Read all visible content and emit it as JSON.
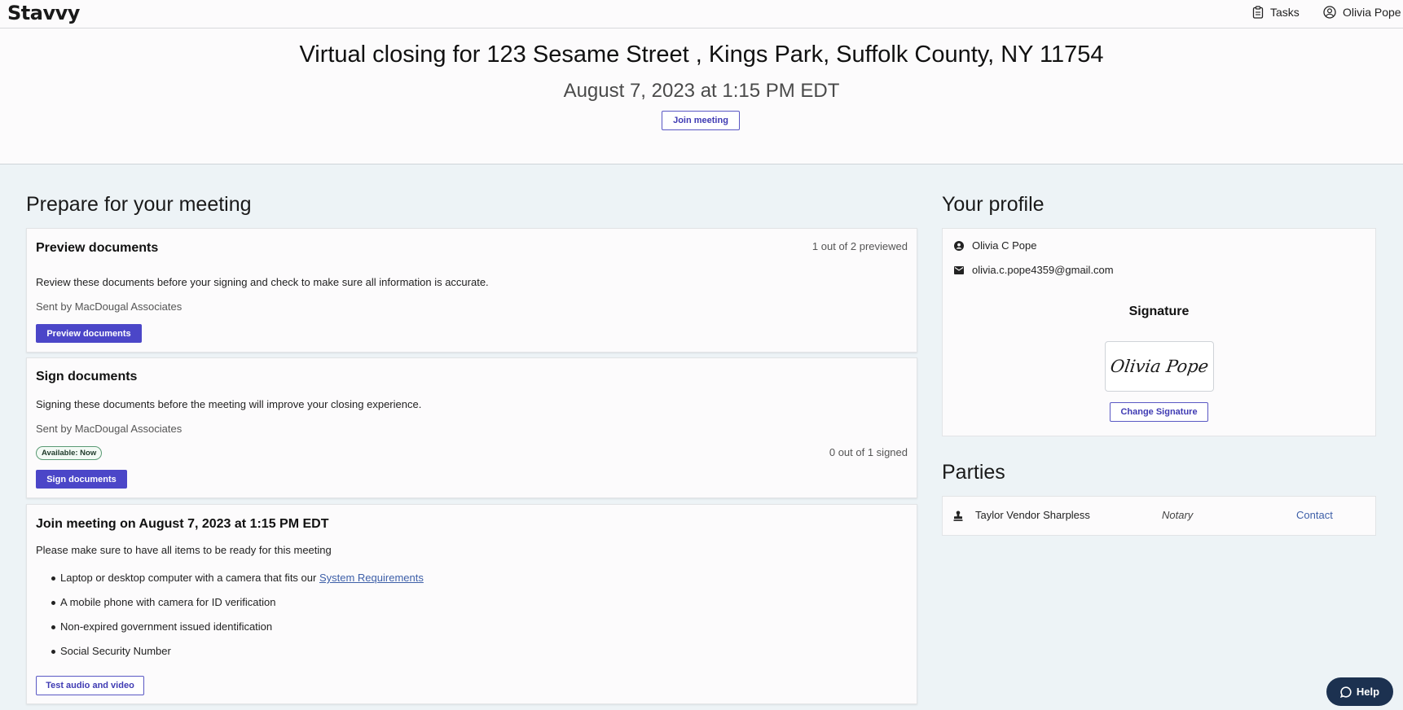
{
  "nav": {
    "logo": "Stavvy",
    "tasks_label": "Tasks",
    "user_name": "Olivia Pope"
  },
  "hero": {
    "title": "Virtual closing for 123 Sesame Street , Kings Park, Suffolk County, NY 11754",
    "date": "August 7, 2023 at 1:15 PM EDT",
    "join_label": "Join meeting"
  },
  "prepare": {
    "heading": "Prepare for your meeting",
    "preview": {
      "title": "Preview documents",
      "counter": "1 out of 2 previewed",
      "description": "Review these documents before your signing and check to make sure all information is accurate.",
      "sender": "Sent by MacDougal Associates",
      "button": "Preview documents"
    },
    "sign": {
      "title": "Sign documents",
      "description": "Signing these documents before the meeting will improve your closing experience.",
      "sender": "Sent by MacDougal Associates",
      "badge": "Available: Now",
      "counter": "0 out of 1 signed",
      "button": "Sign documents"
    },
    "join": {
      "title": "Join meeting on August 7, 2023 at 1:15 PM EDT",
      "intro": "Please make sure to have all items to be ready for this meeting",
      "items": [
        "Laptop or desktop computer with a camera that fits our",
        "A mobile phone with camera for ID verification",
        "Non-expired government issued identification",
        "Social Security Number"
      ],
      "system_link": "System Requirements",
      "test_button": "Test audio and video"
    }
  },
  "profile": {
    "heading": "Your profile",
    "name": "Olivia C Pope",
    "email": "olivia.c.pope4359@gmail.com",
    "signature_heading": "Signature",
    "signature_text": "Olivia Pope",
    "change_signature": "Change Signature"
  },
  "parties": {
    "heading": "Parties",
    "rows": [
      {
        "name": "Taylor Vendor Sharpless",
        "role": "Notary",
        "action": "Contact"
      }
    ]
  },
  "help": {
    "label": "Help"
  },
  "colors": {
    "primary": "#4b46c8",
    "link": "#3d5fa8",
    "help": "#1c3150",
    "page_bg": "#edf3f6"
  }
}
